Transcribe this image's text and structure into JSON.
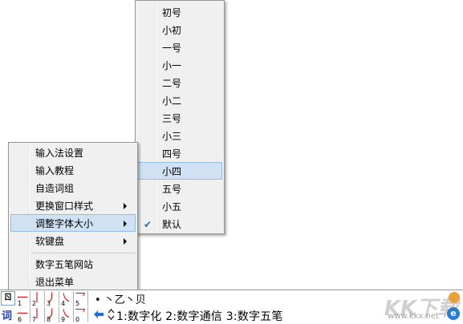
{
  "main_menu": {
    "items": [
      {
        "label": "输入法设置"
      },
      {
        "label": "输入教程"
      },
      {
        "label": "自造词组"
      },
      {
        "label": "更换窗口样式"
      },
      {
        "label": "调整字体大小"
      },
      {
        "label": "软键盘"
      },
      {
        "label": "数字五笔网站"
      },
      {
        "label": "退出菜单"
      }
    ]
  },
  "font_menu": {
    "items": [
      {
        "label": "初号"
      },
      {
        "label": "小初"
      },
      {
        "label": "一号"
      },
      {
        "label": "小一"
      },
      {
        "label": "二号"
      },
      {
        "label": "小二"
      },
      {
        "label": "三号"
      },
      {
        "label": "小三"
      },
      {
        "label": "四号"
      },
      {
        "label": "小四"
      },
      {
        "label": "五号"
      },
      {
        "label": "小五"
      },
      {
        "label": "默认"
      }
    ],
    "checked_mark": "✔"
  },
  "ime": {
    "logo": "ㄖ",
    "ci_label": "词",
    "row1_keys": [
      {
        "glyph": "一",
        "num": "1"
      },
      {
        "glyph": "丨",
        "num": "2"
      },
      {
        "glyph": "丿",
        "num": "3"
      },
      {
        "glyph": "㇏",
        "num": "4"
      },
      {
        "glyph": "乛",
        "num": "5"
      }
    ],
    "row2_keys": [
      {
        "glyph": "一",
        "num": "6"
      },
      {
        "glyph": "丨",
        "num": "7"
      },
      {
        "glyph": "丿",
        "num": "8"
      },
      {
        "glyph": "㇏",
        "num": "9"
      },
      {
        "glyph": "乛",
        "num": "0"
      }
    ],
    "row1_tail": "• 丶乙丶贝",
    "candidates": "1:数字化 2:数字通信 3:数字五笔",
    "watermark": "KK下载",
    "watermark_url": "www.kkx.net"
  }
}
